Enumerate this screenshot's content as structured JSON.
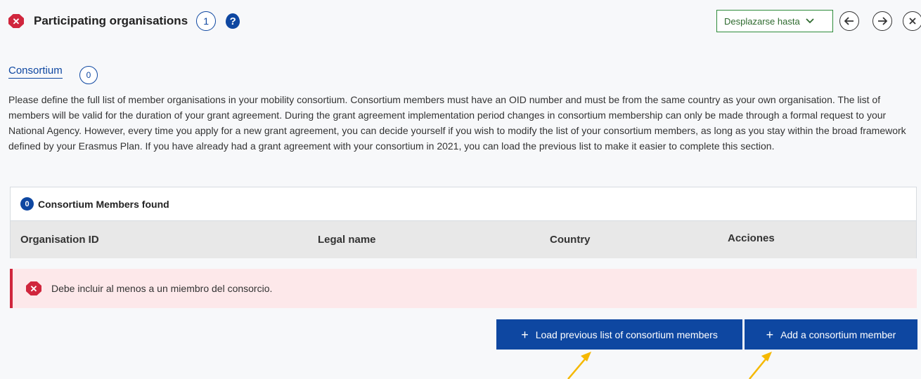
{
  "header": {
    "title": "Participating organisations",
    "count": "1",
    "error_icon": "error-x-icon",
    "help_icon": "help-question-icon"
  },
  "toolbar": {
    "scroll_to": "Desplazarse hasta",
    "prev_icon": "arrow-left-icon",
    "next_icon": "arrow-right-icon",
    "close_icon": "close-icon"
  },
  "consortium": {
    "title": "Consortium",
    "count": "0",
    "description": "Please define the full list of member organisations in your mobility consortium. Consortium members must have an OID number and must be from the same country as your own organisation. The list of members will be valid for the duration of your grant agreement. During the grant agreement implementation period changes in consortium membership can only be made through a formal request to your National Agency. However, every time you apply for a new grant agreement, you can decide yourself if you wish to modify the list of your consortium members, as long as you stay within the broad framework defined by your Erasmus Plan. If you have already had a grant agreement with your consortium in 2021, you can load the previous list to make it easier to complete this section."
  },
  "table": {
    "found_count": "0",
    "found_label": "Consortium Members found",
    "columns": [
      "Organisation ID",
      "Legal name",
      "Country",
      "Acciones"
    ]
  },
  "alert": {
    "message": "Debe incluir al menos a un miembro del consorcio."
  },
  "buttons": {
    "load_previous": "Load previous list of consortium members",
    "add_member": "Add a consortium member",
    "plus_symbol": "+"
  },
  "colors": {
    "primary": "#0e47a1",
    "error": "#d0263d",
    "alert_bg": "#fde8ea",
    "annotation_arrow": "#f5b800",
    "scroll_border": "#2e8b3a"
  }
}
